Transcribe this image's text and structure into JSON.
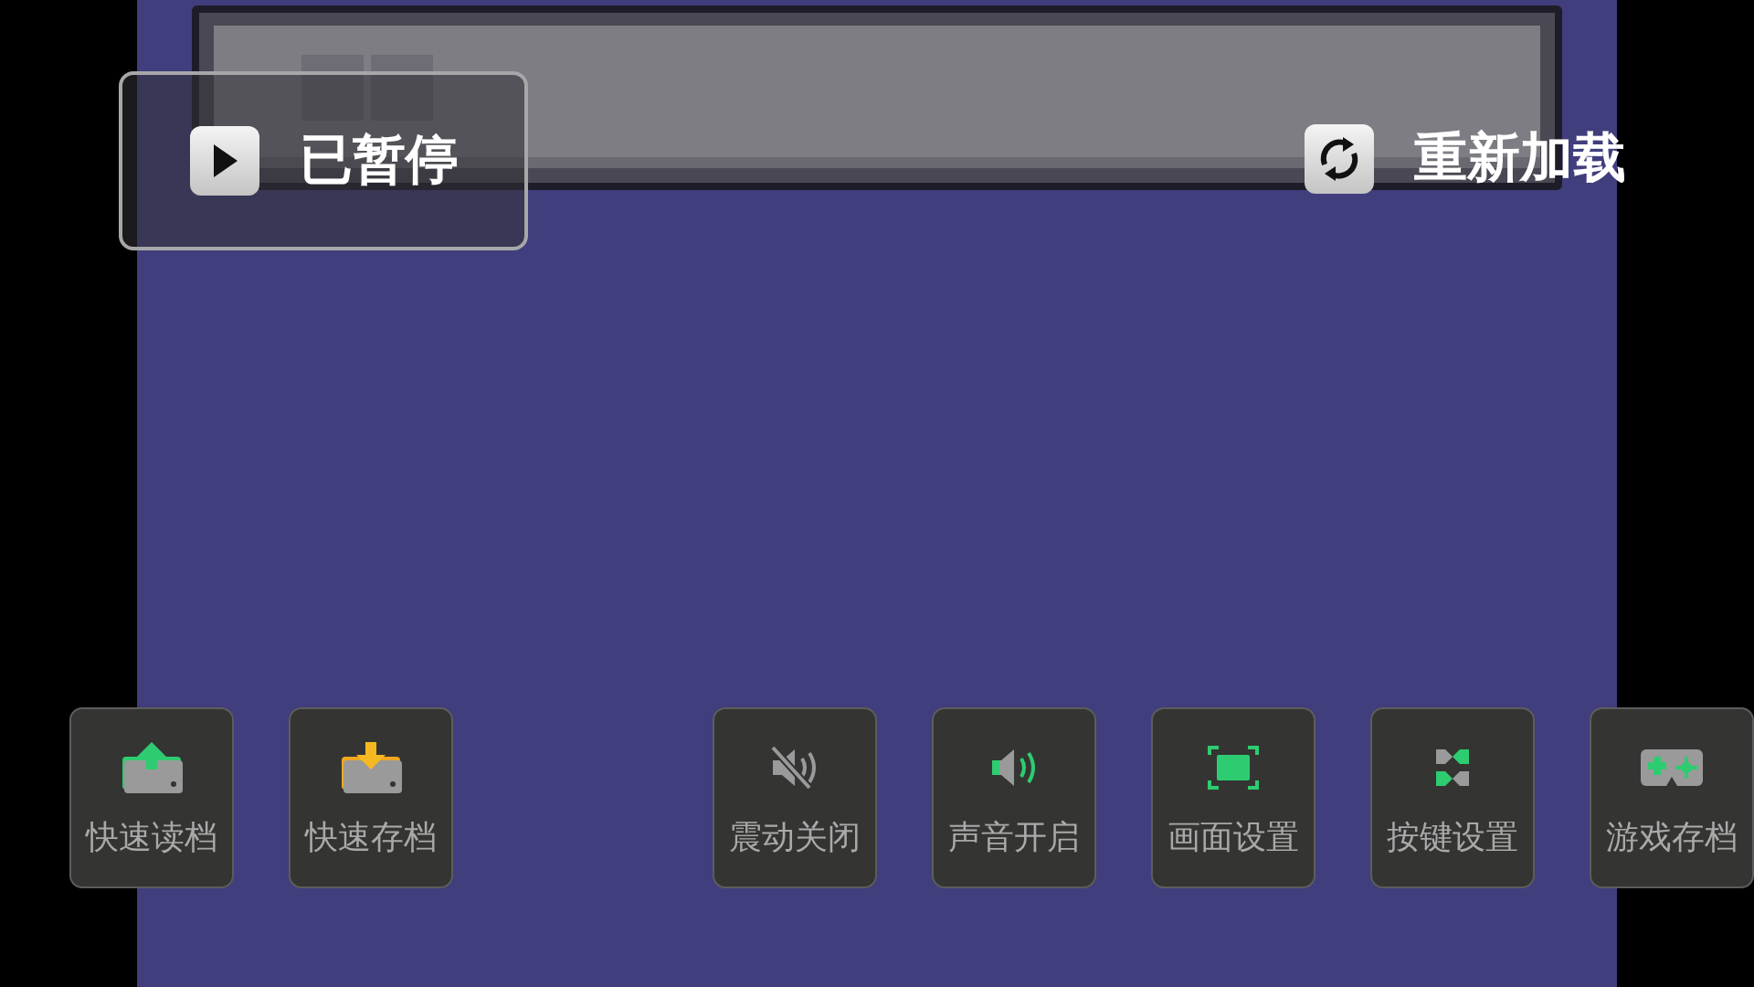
{
  "pause_panel": {
    "label": "已暂停"
  },
  "reload": {
    "label": "重新加载"
  },
  "actions": [
    {
      "kind": "quick_load",
      "label": "快速读档"
    },
    {
      "kind": "quick_save",
      "label": "快速存档"
    },
    {
      "kind": "spacer"
    },
    {
      "kind": "vibration_off",
      "label": "震动关闭"
    },
    {
      "kind": "sound_on",
      "label": "声音开启"
    },
    {
      "kind": "display",
      "label": "画面设置"
    },
    {
      "kind": "keys",
      "label": "按键设置"
    },
    {
      "kind": "saves",
      "label": "游戏存档"
    }
  ]
}
